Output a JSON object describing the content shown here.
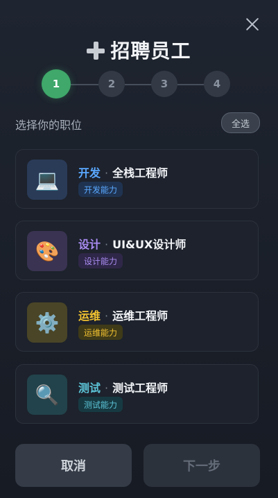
{
  "title": "招聘员工",
  "steps": [
    "1",
    "2",
    "3",
    "4"
  ],
  "active_step": 1,
  "section_label": "选择你的职位",
  "select_all_label": "全选",
  "positions": [
    {
      "category": "开发",
      "role": "全栈工程师",
      "tag": "开发能力",
      "icon": "laptop-icon",
      "glyph": "💻",
      "color": "#5aa8ff",
      "tag_bg": "#1f3350",
      "icon_bg": "#2a3b58"
    },
    {
      "category": "设计",
      "role": "UI&UX设计师",
      "tag": "设计能力",
      "icon": "palette-icon",
      "glyph": "🎨",
      "color": "#a98cf2",
      "tag_bg": "#2f2748",
      "icon_bg": "#3a3352"
    },
    {
      "category": "运维",
      "role": "运维工程师",
      "tag": "运维能力",
      "icon": "gear-icon",
      "glyph": "⚙️",
      "color": "#f2c230",
      "tag_bg": "#3f3a18",
      "icon_bg": "#4a4526"
    },
    {
      "category": "测试",
      "role": "测试工程师",
      "tag": "测试能力",
      "icon": "magnifier-icon",
      "glyph": "🔍",
      "color": "#5cc4d8",
      "tag_bg": "#173a42",
      "icon_bg": "#22434b"
    }
  ],
  "buttons": {
    "cancel": "取消",
    "next": "下一步"
  }
}
